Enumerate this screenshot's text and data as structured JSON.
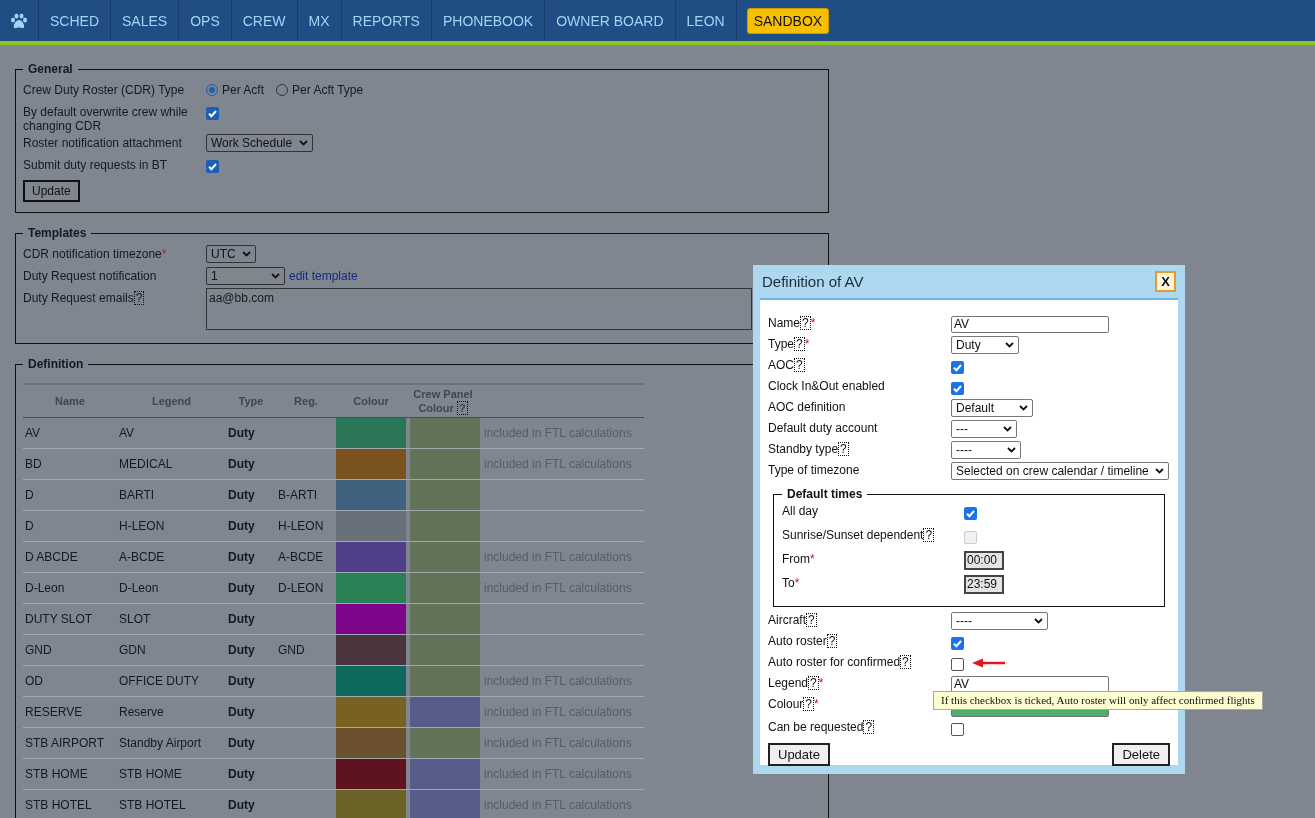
{
  "nav": {
    "items": [
      {
        "label": "SCHED",
        "highlight": false
      },
      {
        "label": "SALES",
        "highlight": false
      },
      {
        "label": "OPS",
        "highlight": false
      },
      {
        "label": "CREW",
        "highlight": false
      },
      {
        "label": "MX",
        "highlight": false
      },
      {
        "label": "REPORTS",
        "highlight": false
      },
      {
        "label": "PHONEBOOK",
        "highlight": false
      },
      {
        "label": "OWNER BOARD",
        "highlight": false
      },
      {
        "label": "LEON",
        "highlight": false
      },
      {
        "label": "SANDBOX",
        "highlight": true
      }
    ]
  },
  "general": {
    "title": "General",
    "fields": [
      {
        "kind": "radio",
        "label": "Crew Duty Roster (CDR) Type",
        "options": [
          {
            "label": "Per Acft",
            "selected": true
          },
          {
            "label": "Per Acft Type",
            "selected": false
          }
        ]
      },
      {
        "kind": "checkbox",
        "label": "By default overwrite crew while changing CDR",
        "checked": true
      },
      {
        "kind": "select",
        "label": "Roster notification attachment",
        "value": "Work Schedule"
      },
      {
        "kind": "checkbox",
        "label": "Submit duty requests in BT",
        "checked": true
      }
    ],
    "button": "Update"
  },
  "templates": {
    "title": "Templates",
    "fields": [
      {
        "kind": "select",
        "label": "CDR notification timezone",
        "required": "*",
        "value": "UTC"
      },
      {
        "kind": "select",
        "label": "Duty Request notification",
        "value": "1",
        "link": "edit template"
      },
      {
        "kind": "textarea",
        "label": "Duty Request emails",
        "help": "?",
        "value": "aa@bb.com"
      }
    ]
  },
  "definition": {
    "title": "Definition",
    "columns": [
      "Name",
      "Legend",
      "Type",
      "Reg.",
      "Colour",
      "Crew Panel Colour"
    ],
    "columns_help": "?",
    "rows": [
      {
        "name": "AV",
        "legend": "AV",
        "type": "Duty",
        "reg": "",
        "colour": {
          "color": "#2a7657"
        },
        "crew_panel": {
          "color": "#62735a"
        },
        "note": "included in FTL calculations"
      },
      {
        "name": "BD",
        "legend": "MEDICAL",
        "type": "Duty",
        "reg": "",
        "colour": {
          "color": "#7a521f"
        },
        "crew_panel": {
          "color": "#62735a"
        },
        "note": "included in FTL calculations"
      },
      {
        "name": "D",
        "legend": "BARTI",
        "type": "Duty",
        "reg": "B-ARTI",
        "colour": {
          "color": "#3f627e"
        },
        "crew_panel": {
          "color": "#62735a"
        },
        "note": ""
      },
      {
        "name": "D",
        "legend": "H-LEON",
        "type": "Duty",
        "reg": "H-LEON",
        "colour": {
          "color": "#687079"
        },
        "crew_panel": {
          "color": "#62735a"
        },
        "note": ""
      },
      {
        "name": "D ABCDE",
        "legend": "A-BCDE",
        "type": "Duty",
        "reg": "A-BCDE",
        "colour": {
          "color": "#513f8a"
        },
        "crew_panel": {
          "color": "#62735a"
        },
        "note": "included in FTL calculations"
      },
      {
        "name": "D-Leon",
        "legend": "D-Leon",
        "type": "Duty",
        "reg": "D-LEON",
        "colour": {
          "color": "#2a8156"
        },
        "crew_panel": {
          "color": "#62735a"
        },
        "note": "included in FTL calculations"
      },
      {
        "name": "DUTY SLOT",
        "legend": "SLOT",
        "type": "Duty",
        "reg": "",
        "colour": {
          "color": "#7c068a"
        },
        "crew_panel": {
          "color": "#62735a"
        },
        "note": ""
      },
      {
        "name": "GND",
        "legend": "GDN",
        "type": "Duty",
        "reg": "GND",
        "colour": {
          "color": "#4a343e"
        },
        "crew_panel": {
          "color": "#62735a"
        },
        "note": ""
      },
      {
        "name": "OD",
        "legend": "OFFICE DUTY",
        "type": "Duty",
        "reg": "",
        "colour": {
          "color": "#0e695c"
        },
        "crew_panel": {
          "color": "#62735a"
        },
        "note": "included in FTL calculations"
      },
      {
        "name": "RESERVE",
        "legend": "Reserve",
        "type": "Duty",
        "reg": "",
        "colour": {
          "color": "#776222"
        },
        "crew_panel": {
          "color": "#575c8b"
        },
        "note": "included in FTL calculations"
      },
      {
        "name": "STB AIRPORT",
        "legend": "Standby Airport",
        "type": "Duty",
        "reg": "",
        "colour": {
          "color": "#6b512e"
        },
        "crew_panel": {
          "color": "#62735a"
        },
        "note": "included in FTL calculations"
      },
      {
        "name": "STB HOME",
        "legend": "STB HOME",
        "type": "Duty",
        "reg": "",
        "colour": {
          "color": "#5e131e"
        },
        "crew_panel": {
          "color": "#575c8b"
        },
        "note": "included in FTL calculations"
      },
      {
        "name": "STB HOTEL",
        "legend": "STB HOTEL",
        "type": "Duty",
        "reg": "",
        "colour": {
          "color": "#6b6228"
        },
        "crew_panel": {
          "color": "#575c8b"
        },
        "note": "included in FTL calculations"
      }
    ]
  },
  "dialog": {
    "title": "Definition of AV",
    "close": "X",
    "fields": [
      {
        "kind": "text",
        "label": "Name",
        "help": "?",
        "required": "*",
        "value": "AV"
      },
      {
        "kind": "select",
        "label": "Type",
        "help": "?",
        "required": "*",
        "value": "Duty"
      },
      {
        "kind": "checkbox",
        "label": "AOC",
        "help": "?",
        "checked": true
      },
      {
        "kind": "checkbox",
        "label": "Clock In&Out enabled",
        "checked": true
      },
      {
        "kind": "select",
        "label": "AOC definition",
        "value": "Default"
      },
      {
        "kind": "select",
        "label": "Default duty account",
        "value": "---"
      },
      {
        "kind": "select",
        "label": "Standby type",
        "help": "?",
        "value": "----"
      },
      {
        "kind": "select",
        "label": "Type of timezone",
        "value": "Selected on crew calendar / timeline"
      },
      {
        "kind": "group",
        "label": "Default times",
        "fields": [
          {
            "kind": "checkbox",
            "label": "All day",
            "checked": true,
            "disabled": false
          },
          {
            "kind": "checkbox",
            "label": "Sunrise/Sunset dependent",
            "help": "?",
            "checked": false,
            "disabled": true
          },
          {
            "kind": "time",
            "label": "From",
            "required": "*",
            "value": "00:00"
          },
          {
            "kind": "time",
            "label": "To",
            "required": "*",
            "value": "23:59"
          }
        ]
      },
      {
        "kind": "select",
        "label": "Aircraft",
        "help": "?",
        "value": "----"
      },
      {
        "kind": "checkbox",
        "label": "Auto roster",
        "help": "?",
        "checked": true
      },
      {
        "kind": "checkbox",
        "label": "Auto roster for confirmed",
        "help": "?",
        "checked": false,
        "pointer": true
      },
      {
        "kind": "text",
        "label": "Legend",
        "help": "?",
        "required": "*",
        "value": "AV"
      },
      {
        "kind": "colour",
        "label": "Colour",
        "help": "?",
        "required": "*",
        "color": "#4caf6a"
      },
      {
        "kind": "checkbox",
        "label": "Can be requested",
        "help": "?",
        "checked": false
      }
    ],
    "buttons": [
      "Update",
      "Delete"
    ],
    "tooltip": "If this checkbox is ticked, Auto roster will only affect confirmed flights"
  }
}
